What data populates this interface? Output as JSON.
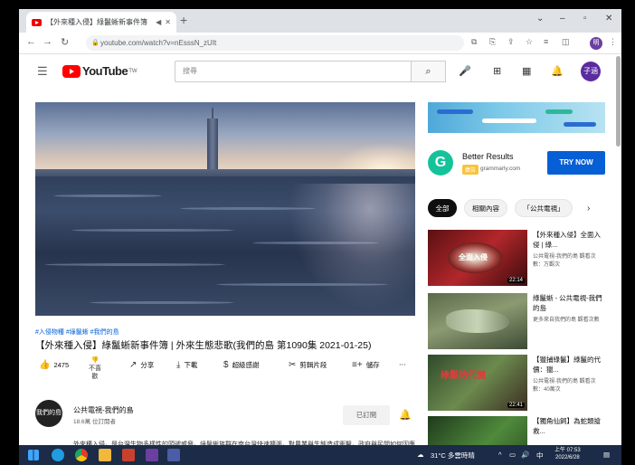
{
  "browser": {
    "tab_title": "【外來種入侵】綠鬣蜥新事件簿",
    "tab_close": "✕",
    "url": "youtube.com/watch?v=nEsssN_zUIt",
    "profile_initial": "明"
  },
  "youtube": {
    "logo_text": "YouTube",
    "logo_region": "TW",
    "search_placeholder": "搜尋",
    "avatar_initial": "子涵"
  },
  "video": {
    "hashtags": "#入侵物種 #綠鬣蜥 #我們的島",
    "title": "【外來種入侵】綠鬣蜥新事件簿 | 外來生態悲歌(我們的島 第1090集 2021-01-25)",
    "likes": "2475",
    "dislike_label": "不喜歡",
    "share_label": "分享",
    "download_label": "下載",
    "thanks_label": "超級感謝",
    "clip_label": "剪輯片段",
    "save_label": "儲存",
    "more_label": "⋯"
  },
  "channel": {
    "avatar_text": "我們的島",
    "name": "公共電視-我們的島",
    "subscribers": "18.6萬 位訂閱者",
    "subscribed_label": "已訂閱",
    "description": "外來種入侵，是台灣生物多樣性的頭號威脅。綠鬣蜥族群在南台灣快速擴張，對農業與生態造成衝擊，政府與民間如何因應..."
  },
  "ad": {
    "logo_letter": "G",
    "title": "Better Results",
    "badge": "廣告",
    "domain": "grammarly.com",
    "cta": "TRY NOW"
  },
  "chips": [
    "全部",
    "相關內容",
    "「公共電視」"
  ],
  "recommendations": [
    {
      "title": "【外來種入侵】全面入侵 | 綠...",
      "meta": "公共電視-我們的島 觀看次數：万觀次",
      "duration": "22:14",
      "thumb_text": "全面入侵"
    },
    {
      "title": "綠鬣蜥 - 公共電視-我們的島",
      "meta": "更多來自我們的島 觀看次數",
      "duration": "",
      "thumb_text": ""
    },
    {
      "title": "【獵捕綠鬣】綠鬣的代價：獵...",
      "meta": "公共電視-我們的島 觀看次數：40萬次",
      "duration": "22:41",
      "thumb_text": "綠鬣的代價"
    },
    {
      "title": "【獨角仙飼】為蛇類搶救...",
      "meta": "",
      "duration": "",
      "thumb_text": ""
    }
  ],
  "taskbar": {
    "weather": "31°C 多雲時晴",
    "lang": "中",
    "time": "上午 07:53",
    "date": "2022/6/28"
  }
}
